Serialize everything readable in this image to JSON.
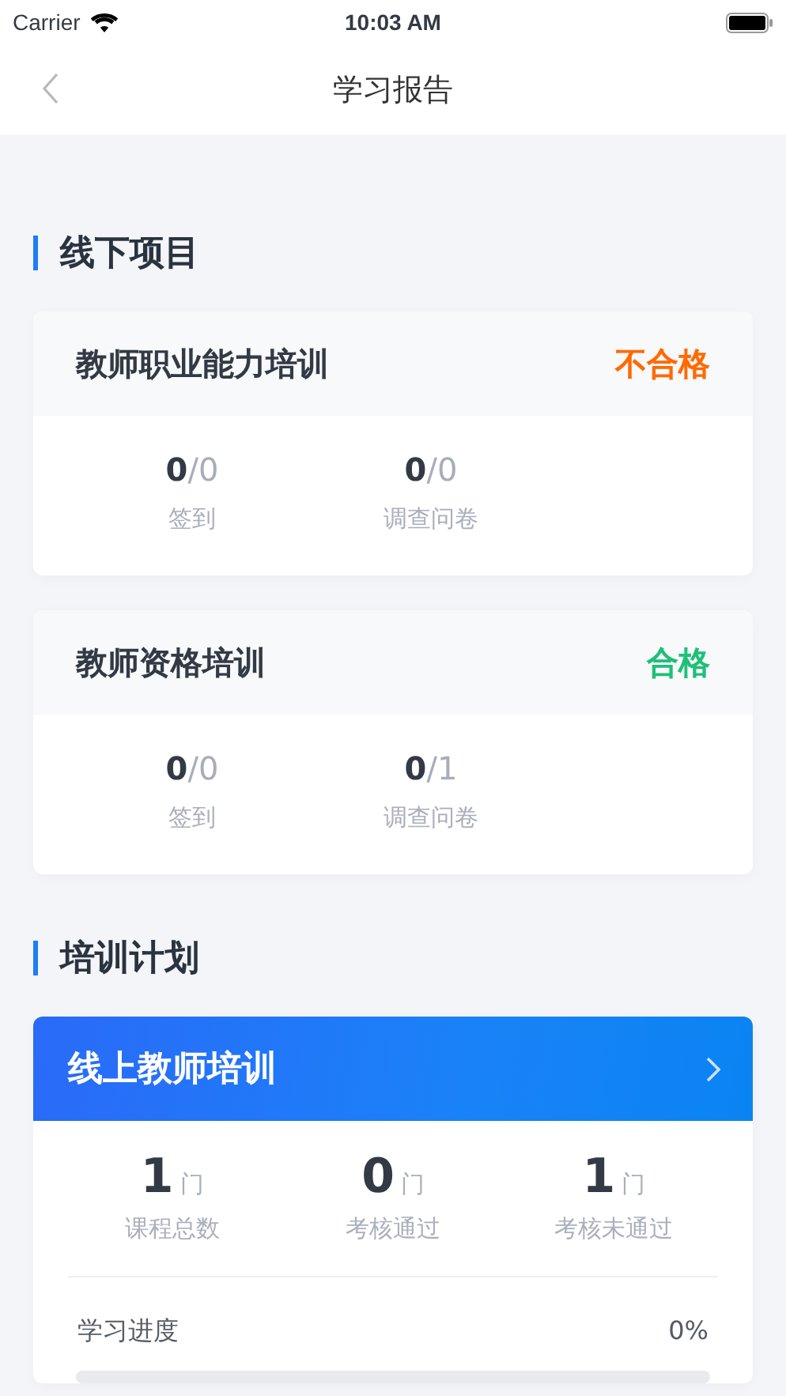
{
  "status_bar": {
    "carrier": "Carrier",
    "time": "10:03 AM"
  },
  "nav": {
    "title": "学习报告"
  },
  "offline": {
    "title": "线下项目",
    "projects": [
      {
        "name": "教师职业能力培训",
        "result": {
          "text": "不合格",
          "kind": "fail"
        },
        "stats": [
          {
            "done": "0",
            "total": "/0",
            "label": "签到"
          },
          {
            "done": "0",
            "total": "/0",
            "label": "调查问卷"
          }
        ]
      },
      {
        "name": "教师资格培训",
        "result": {
          "text": "合格",
          "kind": "pass"
        },
        "stats": [
          {
            "done": "0",
            "total": "/0",
            "label": "签到"
          },
          {
            "done": "0",
            "total": "/1",
            "label": "调查问卷"
          }
        ]
      }
    ]
  },
  "plan": {
    "title": "培训计划",
    "card": {
      "name": "线上教师培训",
      "stats": [
        {
          "count": "1",
          "unit": "门",
          "label": "课程总数"
        },
        {
          "count": "0",
          "unit": "门",
          "label": "考核通过"
        },
        {
          "count": "1",
          "unit": "门",
          "label": "考核未通过"
        }
      ],
      "progress": {
        "label": "学习进度",
        "reading": "0%",
        "level": 0
      }
    }
  }
}
